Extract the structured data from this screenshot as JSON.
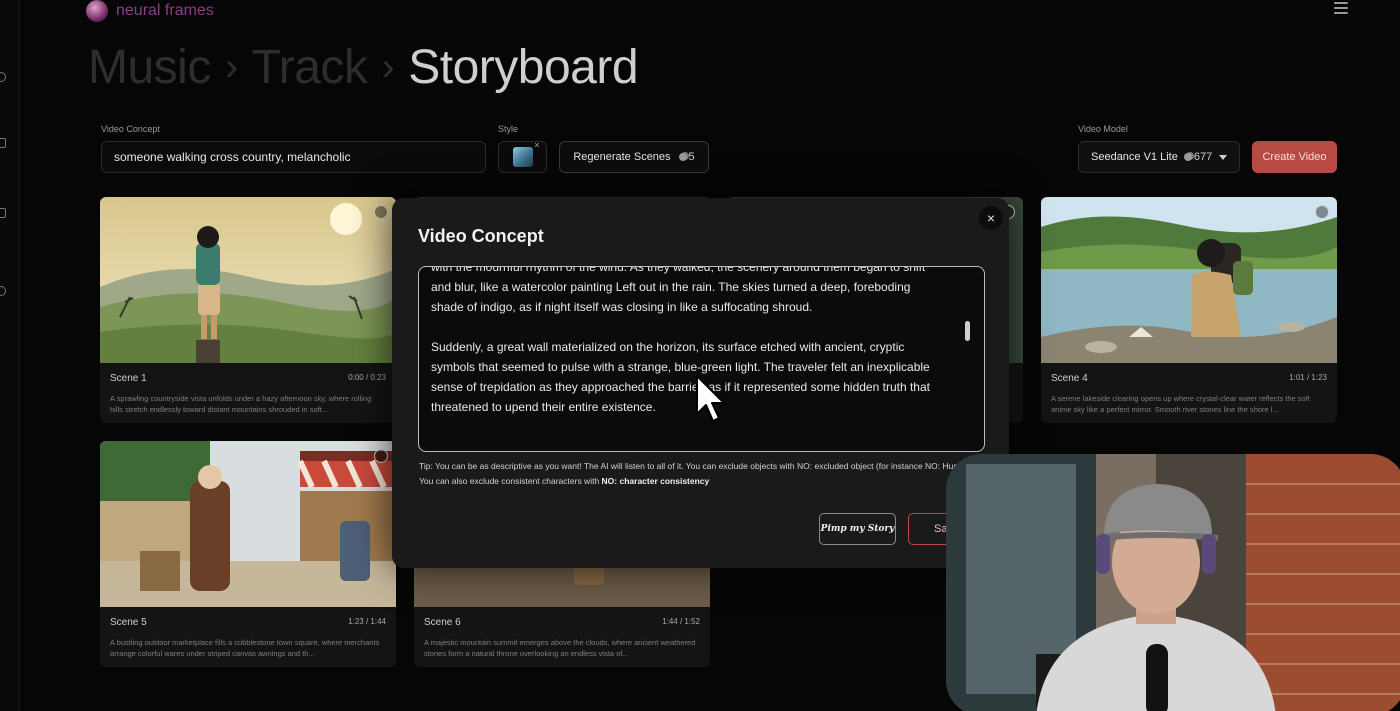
{
  "brand": {
    "name": "neural frames"
  },
  "breadcrumb": {
    "items": [
      "Music",
      "Track",
      "Storyboard"
    ]
  },
  "video_concept": {
    "label": "Video Concept",
    "value": "someone walking cross country, melancholic"
  },
  "style": {
    "label": "Style"
  },
  "regenerate": {
    "label": "Regenerate Scenes",
    "cost": "5"
  },
  "video_model": {
    "label": "Video Model",
    "value": "Seedance V1 Lite",
    "credits": "677"
  },
  "create_video": {
    "label": "Create Video"
  },
  "scenes": [
    {
      "title": "Scene 1",
      "time": "0:00 / 0:23",
      "desc": "A sprawling countryside vista unfolds under a hazy afternoon sky, where rolling hills stretch endlessly toward distant mountains shrouded in soft..."
    },
    {
      "title": "Scene 4",
      "time": "1:01 / 1:23",
      "desc": "A serene lakeside clearing opens up where crystal-clear water reflects the soft anime sky like a perfect mirror. Smooth river stones line the shore l..."
    },
    {
      "title": "Scene 5",
      "time": "1:23 / 1:44",
      "desc": "A bustling outdoor marketplace fills a cobblestone town square, where merchants arrange colorful wares under striped canvas awnings and th..."
    },
    {
      "title": "Scene 6",
      "time": "1:44 / 1:52",
      "desc": "A majestic mountain summit emerges above the clouds, where ancient weathered stones form a natural throne overlooking an endless vista of..."
    }
  ],
  "modal": {
    "title": "Video Concept",
    "paragraphs": [
      "with the mournful rhythm of the wind. As they walked, the scenery around them began to shift and blur, like a watercolor painting Left out in the rain. The skies turned a deep, foreboding shade of indigo, as if night itself was closing in like a suffocating shroud.",
      "Suddenly, a great wall materialized on the horizon, its surface etched with ancient, cryptic symbols that seemed to pulse with a strange, blue-green light. The traveler felt an inexplicable sense of trepidation as they approached the barrier, as if it represented some hidden truth that threatened to upend their entire existence."
    ],
    "tip_text": "Tip: You can be as descriptive as you want! The AI will listen to all of it. You can exclude objects with NO: excluded object (for instance NO: Humans). You can also exclude consistent characters with ",
    "tip_bold": "NO: character consistency",
    "pimp_label": "Pimp my Story",
    "save_label": "Save",
    "close_label": "×"
  },
  "icons": {
    "brand": "neural-frames-logo",
    "menu": "hamburger-icon",
    "credits": "coins-icon",
    "refresh": "refresh-icon",
    "close": "close-icon",
    "cursor": "mouse-cursor"
  },
  "colors": {
    "accent": "#b84a44",
    "background": "#060606",
    "card": "#141414",
    "modal": "#1a1a1a"
  }
}
